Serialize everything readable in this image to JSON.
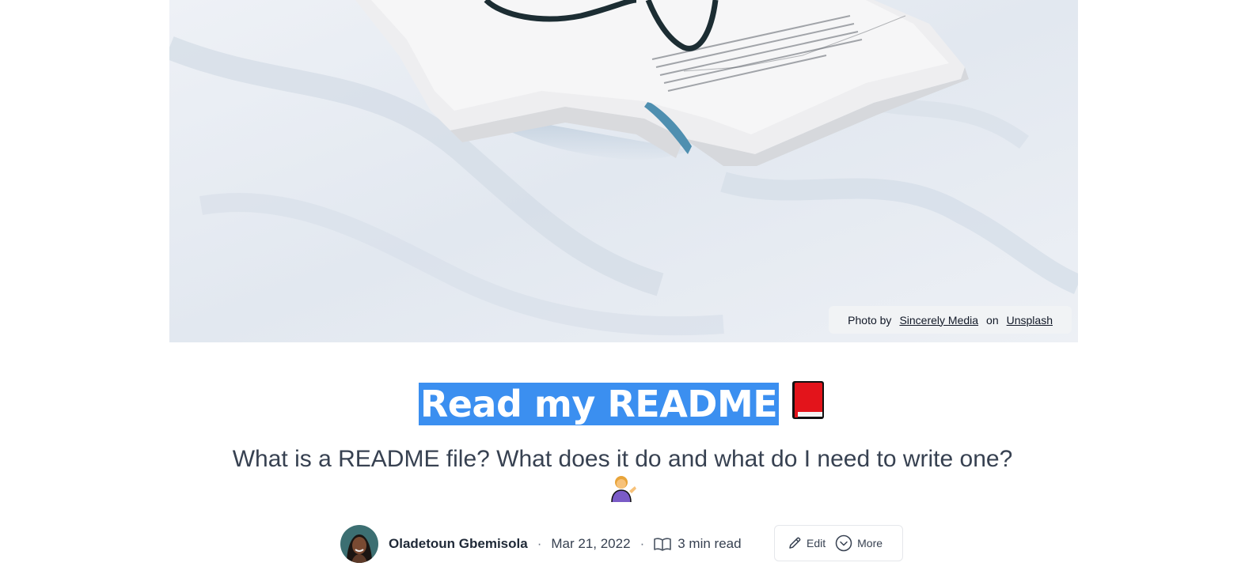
{
  "cover": {
    "credit_prefix": "Photo by",
    "photographer": "Sincerely Media",
    "credit_joiner": "on",
    "source": "Unsplash"
  },
  "article": {
    "title": "Read my README",
    "title_emoji": "closed-book-icon",
    "subtitle": "What is a README file? What does it do and what do I need to write one?",
    "subtitle_emoji": "person-tipping-hand-icon",
    "selection_color": "#3b8ff0"
  },
  "meta": {
    "author": "Oladetoun Gbemisola",
    "separator": "·",
    "date": "Mar 21, 2022",
    "read_time": "3 min read"
  },
  "actions": {
    "edit_label": "Edit",
    "more_label": "More"
  }
}
